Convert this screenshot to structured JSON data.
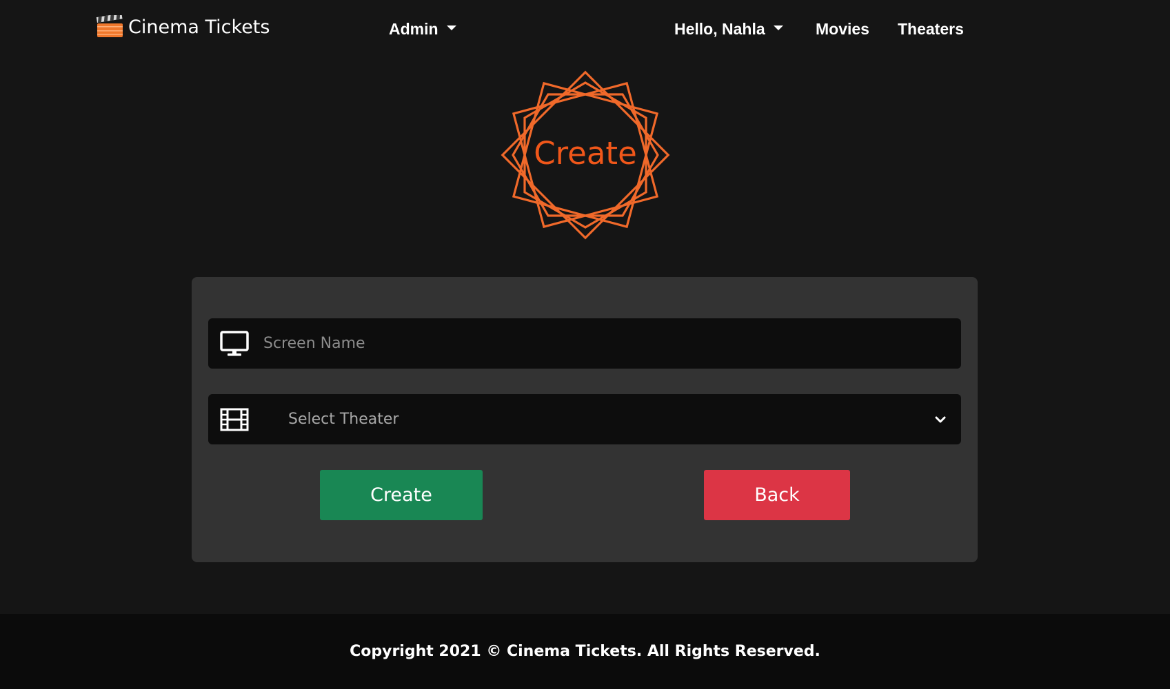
{
  "brand": {
    "name": "Cinema Tickets",
    "icon": "clapperboard-icon",
    "icon_color": "#f0782c"
  },
  "nav": {
    "admin_label": "Admin",
    "user_label": "Hello, Nahla",
    "movies_label": "Movies",
    "theaters_label": "Theaters"
  },
  "badge": {
    "label": "Create",
    "color": "#f0571a"
  },
  "form": {
    "screen_name": {
      "value": "",
      "placeholder": "Screen Name",
      "icon": "monitor-icon"
    },
    "theater": {
      "selected": "Select Theater",
      "icon": "film-icon"
    },
    "create_label": "Create",
    "back_label": "Back",
    "create_color": "#198754",
    "back_color": "#dc3545"
  },
  "footer": {
    "text": "Copyright 2021 © Cinema Tickets. All Rights Reserved."
  }
}
